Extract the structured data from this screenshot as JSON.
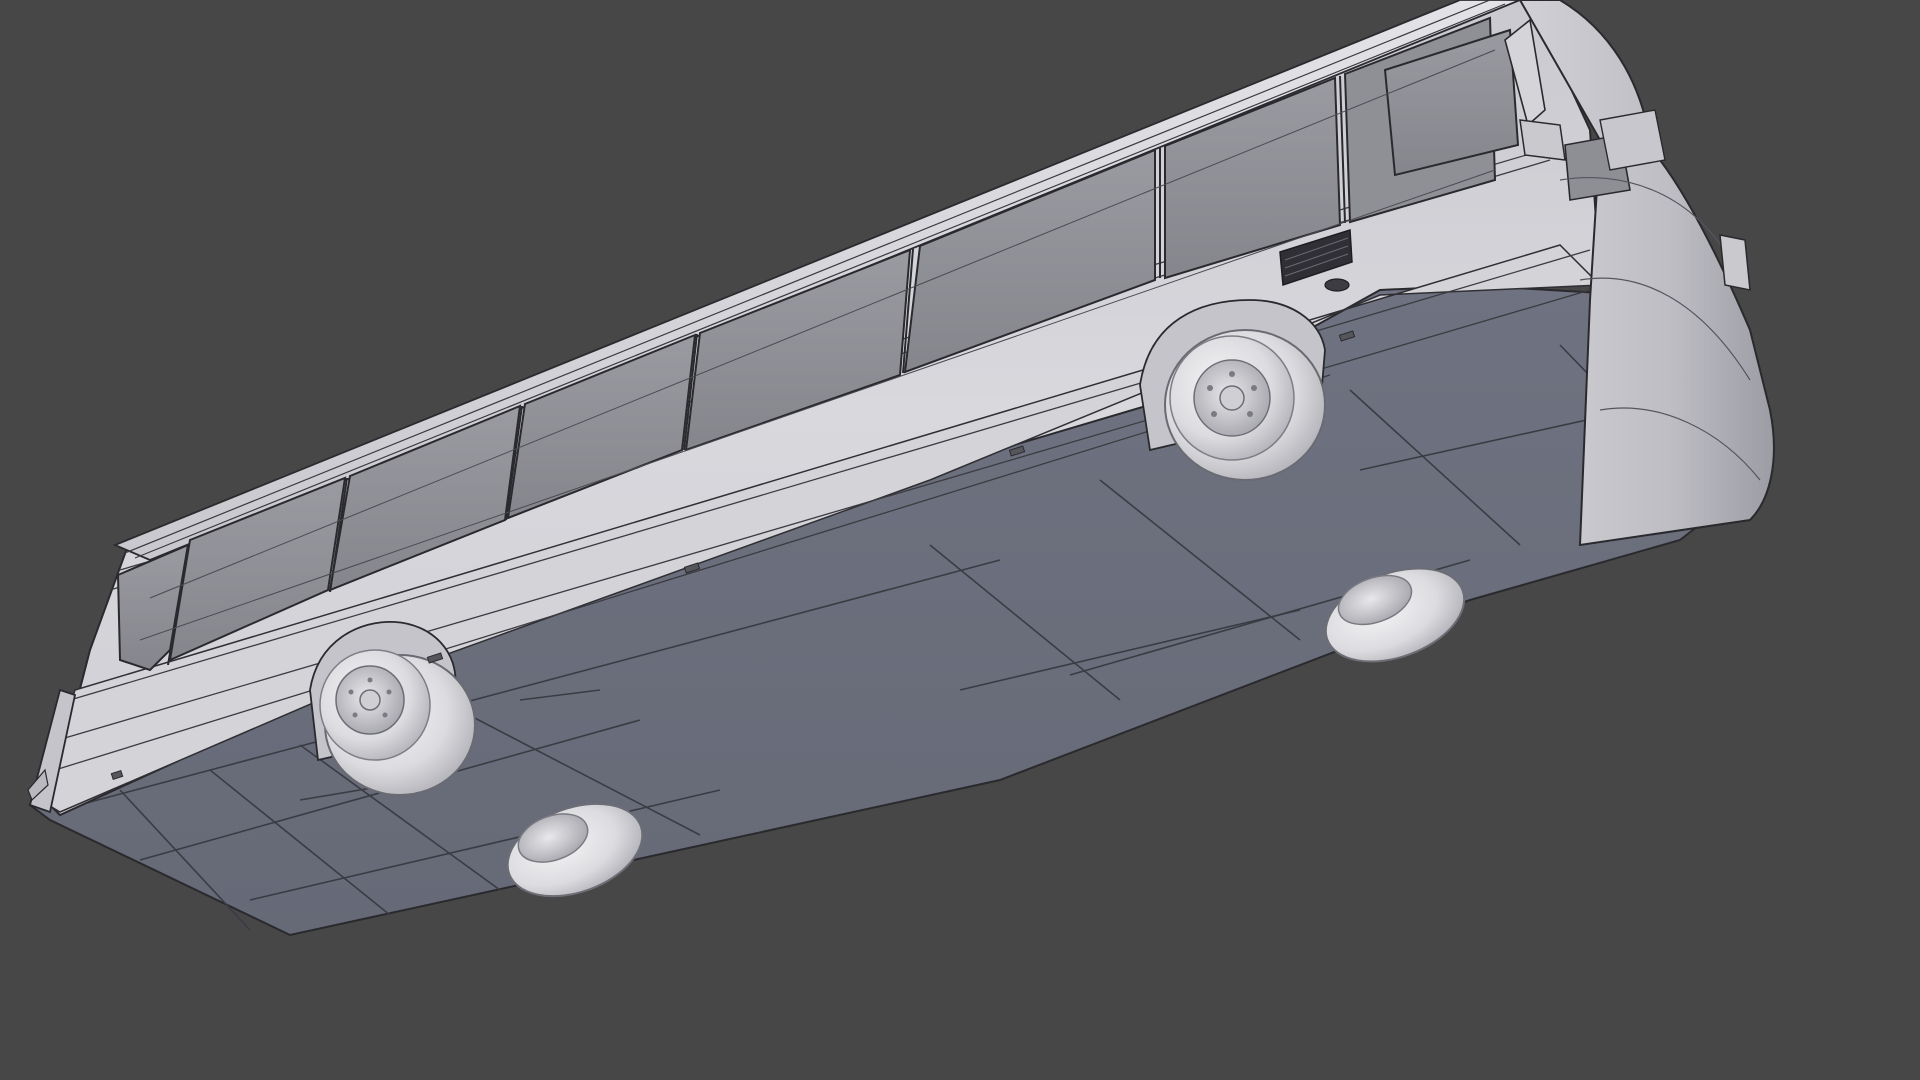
{
  "viewport": {
    "background_color": "#474747",
    "shading": "solid",
    "overlay": "wireframe-edges"
  },
  "model": {
    "object": "bus",
    "body_color": "#d9d9dd",
    "underside_color": "#6c6f7c",
    "glass_color": "#8e8e95",
    "edge_color": "#2b2b2f",
    "tire_color": "#e2e2e5",
    "window_count": 8,
    "visible_wheels": 4
  }
}
